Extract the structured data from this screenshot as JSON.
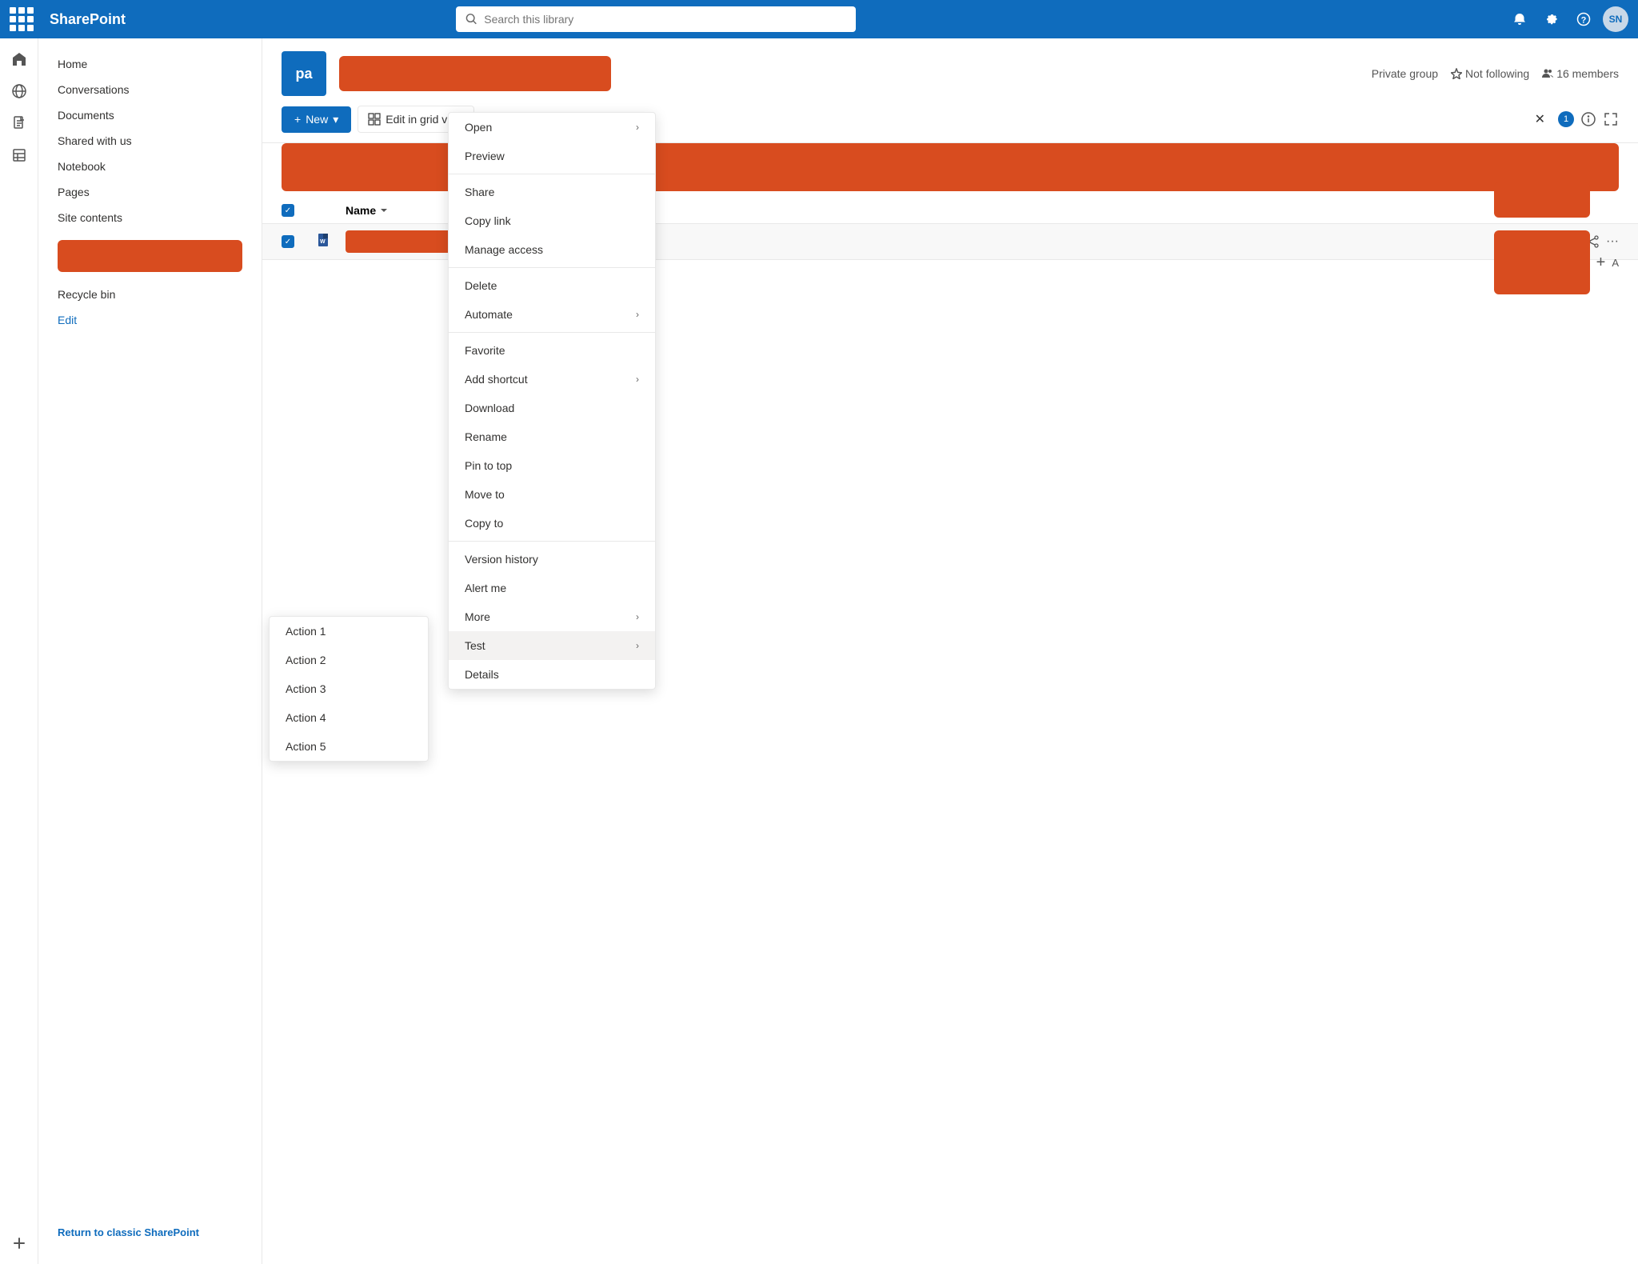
{
  "topNav": {
    "title": "SharePoint",
    "searchPlaceholder": "Search this library",
    "avatarText": "SN"
  },
  "leftRail": {
    "icons": [
      "home",
      "globe",
      "document",
      "list",
      "plus"
    ]
  },
  "sidebar": {
    "items": [
      {
        "label": "Home"
      },
      {
        "label": "Conversations"
      },
      {
        "label": "Documents"
      },
      {
        "label": "Shared with us"
      },
      {
        "label": "Notebook"
      },
      {
        "label": "Pages"
      },
      {
        "label": "Site contents"
      }
    ],
    "editLabel": "Edit",
    "returnLabel": "Return to classic SharePoint"
  },
  "siteHeader": {
    "iconText": "pa",
    "privateLabel": "Private group",
    "followingLabel": "Not following",
    "membersLabel": "16 members"
  },
  "toolbar": {
    "newLabel": "New",
    "editGridLabel": "Edit in grid view",
    "selectedCount": "1"
  },
  "table": {
    "nameColumn": "Name"
  },
  "contextMenu": {
    "items": [
      {
        "label": "Open",
        "hasSubmenu": true
      },
      {
        "label": "Preview",
        "hasSubmenu": false
      },
      {
        "label": "Share",
        "hasSubmenu": false
      },
      {
        "label": "Copy link",
        "hasSubmenu": false
      },
      {
        "label": "Manage access",
        "hasSubmenu": false
      },
      {
        "label": "Delete",
        "hasSubmenu": false
      },
      {
        "label": "Automate",
        "hasSubmenu": true
      },
      {
        "label": "Favorite",
        "hasSubmenu": false
      },
      {
        "label": "Add shortcut",
        "hasSubmenu": true
      },
      {
        "label": "Download",
        "hasSubmenu": false
      },
      {
        "label": "Rename",
        "hasSubmenu": false
      },
      {
        "label": "Pin to top",
        "hasSubmenu": false
      },
      {
        "label": "Move to",
        "hasSubmenu": false
      },
      {
        "label": "Copy to",
        "hasSubmenu": false
      },
      {
        "label": "Version history",
        "hasSubmenu": false
      },
      {
        "label": "Alert me",
        "hasSubmenu": false
      },
      {
        "label": "More",
        "hasSubmenu": true
      },
      {
        "label": "Test",
        "hasSubmenu": true,
        "active": true
      },
      {
        "label": "Details",
        "hasSubmenu": false
      }
    ]
  },
  "actionsMenu": {
    "items": [
      {
        "label": "Action 1"
      },
      {
        "label": "Action 2"
      },
      {
        "label": "Action 3"
      },
      {
        "label": "Action 4"
      },
      {
        "label": "Action 5"
      }
    ]
  }
}
